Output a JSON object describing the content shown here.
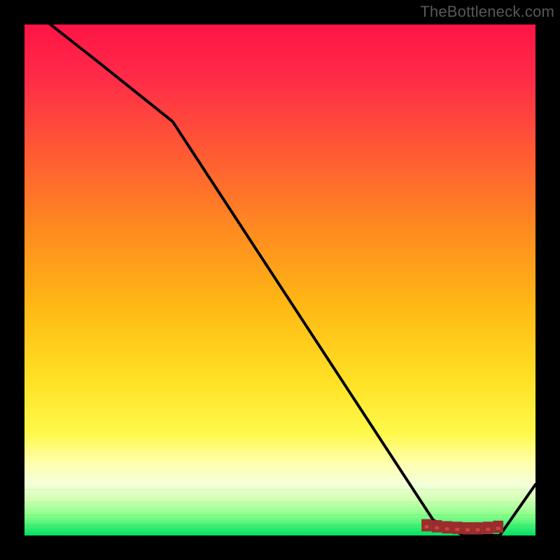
{
  "watermark": "TheBottleneck.com",
  "domain": "Chart",
  "chart_data": {
    "type": "line",
    "title": "",
    "xlabel": "",
    "ylabel": "",
    "xlim": [
      0,
      100
    ],
    "ylim": [
      0,
      100
    ],
    "series": [
      {
        "name": "curve",
        "x": [
          0,
          14,
          29,
          80,
          86,
          93,
          100
        ],
        "y": [
          104,
          93,
          81,
          3,
          0,
          0,
          10
        ]
      }
    ],
    "markers": {
      "name": "highlight-band",
      "x_range": [
        78,
        93
      ],
      "y_level": 2
    },
    "background": "heat-gradient (red top → yellow mid → green bottom)"
  },
  "colors": {
    "bg_black": "#000000",
    "grad_top": "#ff1744",
    "grad_mid_upper": "#ff8a00",
    "grad_mid": "#ffd400",
    "grad_lower": "#ffff66",
    "grad_base1": "#e8ffb0",
    "grad_base2": "#88ff88",
    "grad_bottom": "#00e676",
    "curve": "#000000",
    "marker_fill": "#cc4444",
    "marker_stroke": "#9a2c2c",
    "watermark": "#585858"
  }
}
